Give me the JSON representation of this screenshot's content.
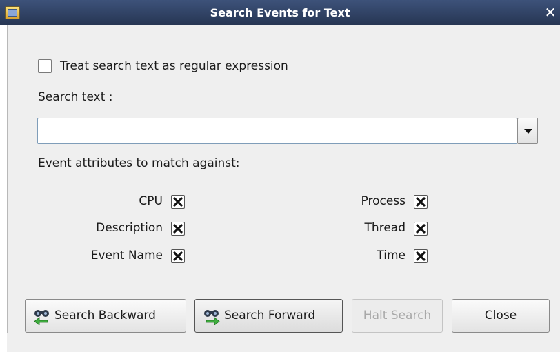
{
  "window": {
    "title": "Search Events for Text",
    "close_glyph": "✕"
  },
  "options": {
    "regex_label": "Treat search text as regular expression",
    "regex_checked": false
  },
  "search": {
    "label": "Search text :",
    "value": ""
  },
  "attributes": {
    "heading": "Event attributes to match against:",
    "left": [
      {
        "label": "CPU",
        "checked": true
      },
      {
        "label": "Description",
        "checked": true
      },
      {
        "label": "Event Name",
        "checked": true
      }
    ],
    "right": [
      {
        "label": "Process",
        "checked": true
      },
      {
        "label": "Thread",
        "checked": true
      },
      {
        "label": "Time",
        "checked": true
      }
    ]
  },
  "buttons": {
    "backward": {
      "pre": "Search Bac",
      "mnemonic": "k",
      "post": "ward"
    },
    "forward": {
      "pre": "Sea",
      "mnemonic": "r",
      "post": "ch Forward"
    },
    "halt": "Halt Search",
    "close": "Close"
  },
  "icons": {
    "app": "app-window-icon",
    "backward": "binoculars-back-icon",
    "forward": "binoculars-forward-icon",
    "checkbox_mark": "x-mark"
  },
  "colors": {
    "titlebar": "#2f4066",
    "dialog_bg": "#efefef",
    "entry_border": "#7f9db9"
  }
}
